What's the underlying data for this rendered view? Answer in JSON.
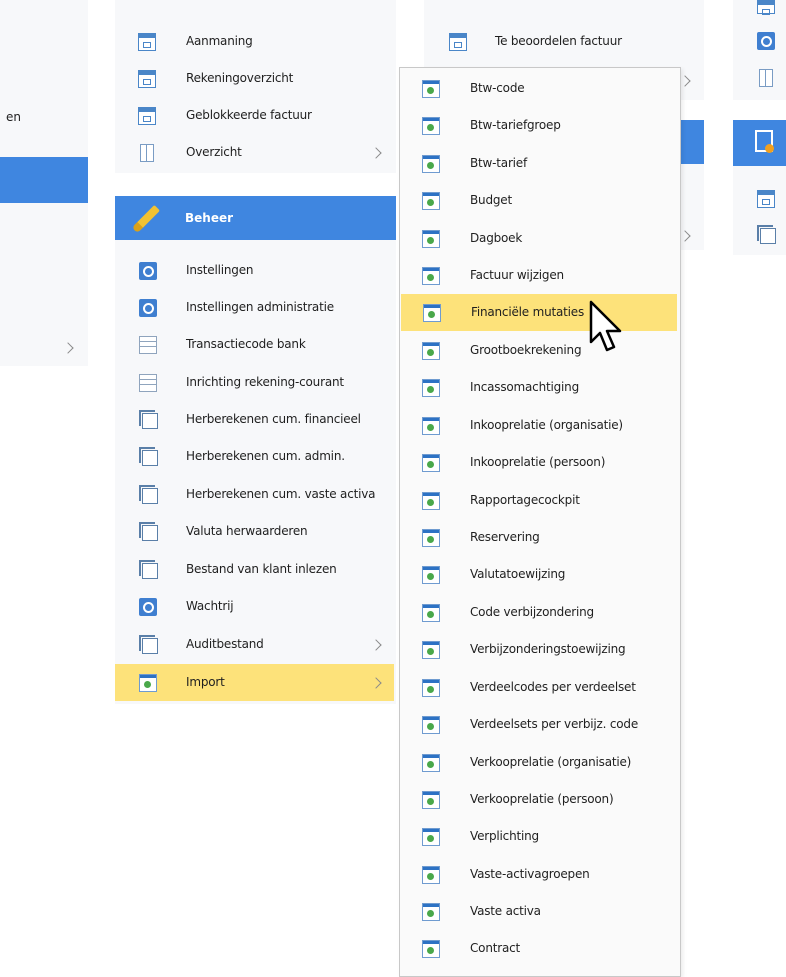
{
  "left_partial": {
    "text_fragment": "en"
  },
  "col2_top": {
    "items": [
      {
        "label": "Aanmaning",
        "icon": "document-icon"
      },
      {
        "label": "Rekeningoverzicht",
        "icon": "document-icon"
      },
      {
        "label": "Geblokkeerde factuur",
        "icon": "document-icon"
      },
      {
        "label": "Overzicht",
        "icon": "page-icon",
        "submenu": true
      }
    ]
  },
  "col3_top": {
    "items": [
      {
        "label": "Te beoordelen factuur",
        "icon": "document-icon"
      }
    ]
  },
  "beheer": {
    "title": "Beheer",
    "items": [
      {
        "label": "Instellingen",
        "icon": "gear-icon"
      },
      {
        "label": "Instellingen administratie",
        "icon": "gear-icon"
      },
      {
        "label": "Transactiecode bank",
        "icon": "table-icon"
      },
      {
        "label": "Inrichting rekening-courant",
        "icon": "table-icon"
      },
      {
        "label": "Herberekenen cum. financieel",
        "icon": "window-icon"
      },
      {
        "label": "Herberekenen cum. admin.",
        "icon": "window-icon"
      },
      {
        "label": "Herberekenen cum. vaste activa",
        "icon": "window-icon"
      },
      {
        "label": "Valuta herwaarderen",
        "icon": "window-icon"
      },
      {
        "label": "Bestand van klant inlezen",
        "icon": "window-icon"
      },
      {
        "label": "Wachtrij",
        "icon": "gear-icon"
      },
      {
        "label": "Auditbestand",
        "icon": "window-icon",
        "submenu": true
      },
      {
        "label": "Import",
        "icon": "import-icon",
        "submenu": true,
        "highlighted": true
      }
    ]
  },
  "import_submenu": {
    "items": [
      {
        "label": "Btw-code"
      },
      {
        "label": "Btw-tariefgroep"
      },
      {
        "label": "Btw-tarief"
      },
      {
        "label": "Budget"
      },
      {
        "label": "Dagboek"
      },
      {
        "label": "Factuur wijzigen"
      },
      {
        "label": "Financiële mutaties",
        "highlighted": true
      },
      {
        "label": "Grootboekrekening"
      },
      {
        "label": "Incassomachtiging"
      },
      {
        "label": "Inkooprelatie (organisatie)"
      },
      {
        "label": "Inkooprelatie (persoon)"
      },
      {
        "label": "Rapportagecockpit"
      },
      {
        "label": "Reservering"
      },
      {
        "label": "Valutatoewijzing"
      },
      {
        "label": "Code verbijzondering"
      },
      {
        "label": "Verbijzonderingstoewijzing"
      },
      {
        "label": "Verdeelcodes per verdeelset"
      },
      {
        "label": "Verdeelsets per verbijz. code"
      },
      {
        "label": "Verkooprelatie (organisatie)"
      },
      {
        "label": "Verkooprelatie (persoon)"
      },
      {
        "label": "Verplichting"
      },
      {
        "label": "Vaste-activagroepen"
      },
      {
        "label": "Vaste activa"
      },
      {
        "label": "Contract"
      }
    ]
  },
  "colors": {
    "highlight": "#fde27a",
    "header_blue": "#3f86e0",
    "import_icon_green": "#4aa84a"
  }
}
